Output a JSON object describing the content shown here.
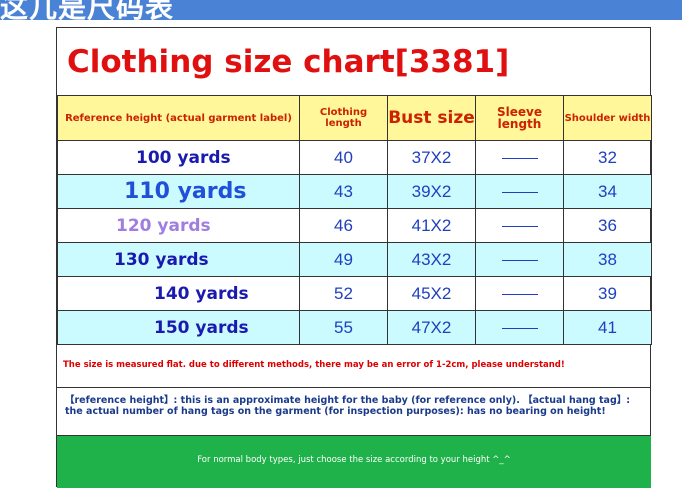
{
  "banner": {
    "text": "这几是尺码表"
  },
  "title": "Clothing size chart[3381]",
  "headers": [
    "Reference height (actual garment label)",
    "Clothing length",
    "Bust size",
    "Sleeve length",
    "Shoulder width"
  ],
  "rows": [
    {
      "height": "100 yards",
      "length": "40",
      "bust": "37X2",
      "sleeve": "——",
      "shoulder": "32"
    },
    {
      "height": "110 yards",
      "length": "43",
      "bust": "39X2",
      "sleeve": "——",
      "shoulder": "34"
    },
    {
      "height": "120 yards",
      "length": "46",
      "bust": "41X2",
      "sleeve": "——",
      "shoulder": "36"
    },
    {
      "height": "130 yards",
      "length": "49",
      "bust": "43X2",
      "sleeve": "——",
      "shoulder": "38"
    },
    {
      "height": "140 yards",
      "length": "52",
      "bust": "45X2",
      "sleeve": "——",
      "shoulder": "39"
    },
    {
      "height": "150 yards",
      "length": "55",
      "bust": "47X2",
      "sleeve": "——",
      "shoulder": "41"
    }
  ],
  "note_measure": "The size is measured flat. due to different methods, there may be an error of 1-2cm, please understand!",
  "note_reference": "【reference height】: this is an approximate height for the baby (for reference only). 【actual hang tag】: the actual number of hang tags on the garment (for inspection purposes): has no bearing on height!",
  "footer_text": "For normal body types, just choose the size according to your height  ^_^",
  "colors": {
    "title": "#e01010",
    "header_bg": "#fff79a",
    "row_alt_bg": "#ccfbff",
    "footer_bg": "#1fb14a",
    "banner_bg": "#4a82d6"
  }
}
